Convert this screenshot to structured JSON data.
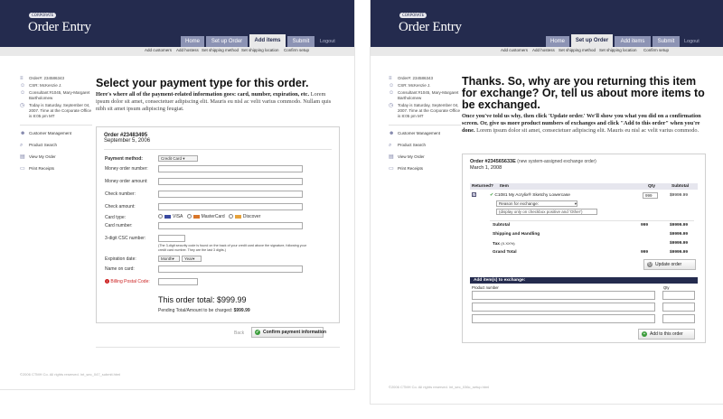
{
  "left": {
    "brand_tag": "CORPORATE",
    "brand": "Order Entry",
    "tabs": [
      "Home",
      "Set up Order",
      "Add items",
      "Submit"
    ],
    "logout": "Logout",
    "subnav": [
      "Add customers",
      "Add hostess",
      "Set shipping method",
      "Set shipping location",
      "Confirm setup"
    ],
    "side_info": [
      {
        "icon": "≡",
        "text": "Order#: 234586343"
      },
      {
        "icon": "☺",
        "text": "CSR: McKenzie J."
      },
      {
        "icon": "☺",
        "text": "Consultant:#1045, Mary-Margaret Bartholomew"
      },
      {
        "icon": "◷",
        "text": "Today is Saturday, September 04, 2007. Time at the Corporate Office is 8:05 pm MT"
      }
    ],
    "side_links": [
      "Customer Management",
      "Product Search",
      "View My Order",
      "Print Receipts"
    ],
    "title": "Select your payment type for this order.",
    "intro_bold": "Here's where all of the payment-related information goes: card, number, expiration, etc.",
    "intro_rest": "Lorem ipsum dolor sit amet, consectetuer adipiscing elit. Mauris eu nisl ac velit varius commodo. Nullam quis nibh sit amet ipsum adipiscing feugiat.",
    "order_no": "Order #23483495",
    "order_date": "September 5, 2006",
    "payment_method_label": "Payment method:",
    "payment_method_value": "Credit Card",
    "fields": [
      "Money order number:",
      "Money order amount:",
      "Check number:",
      "Check amount:"
    ],
    "card_type_label": "Card type:",
    "card_types": [
      "VISA",
      "MasterCard",
      "Discover"
    ],
    "card_number_label": "Card number:",
    "csc_label": "3-digit CSC number:",
    "csc_help": "(The 3-digit security code is found on the back of your credit card above the signature, following your credit card number. They are the last 3 digits.)",
    "exp_label": "Expiration date:",
    "exp_month": "Month",
    "exp_year": "Year",
    "name_label": "Name on card:",
    "billing_label": "Billing Postal Code:",
    "total_label": "This order total: $999.99",
    "pending_label": "Pending Total/Amount to be charged:",
    "pending_value": "$999.99",
    "back": "Back",
    "confirm_button": "Confirm payment information",
    "footer": "©2006 CTMH Co. All rights reserved. int_sec_047_submit.html"
  },
  "right": {
    "brand_tag": "CORPORATE",
    "brand": "Order Entry",
    "tabs": [
      "Home",
      "Set up Order",
      "Add items",
      "Submit"
    ],
    "logout": "Logout",
    "subnav": [
      "Add customers",
      "Add hostess",
      "Set shipping method",
      "Set shipping location",
      "Confirm setup"
    ],
    "side_info": [
      {
        "icon": "≡",
        "text": "Order#: 234586343"
      },
      {
        "icon": "☺",
        "text": "CSR: McKenzie J."
      },
      {
        "icon": "☺",
        "text": "Consultant:#1045, Mary-Margaret Bartholomew"
      },
      {
        "icon": "◷",
        "text": "Today is Saturday, September 04, 2007. Time at the Corporate Office is 8:05 pm MT"
      }
    ],
    "side_links": [
      "Customer Management",
      "Product Search",
      "View My Order",
      "Print Receipts"
    ],
    "title": "Thanks. So, why are you returning this item for exchange? Or, tell us about more items to be exchanged.",
    "intro_bold": "Once you've told us why, then click 'Update order.' We'll show you what you did on a confirmation screen. Or, give us more product numbers of exchanges and click \"Add to this order\" when you're done.",
    "intro_rest": "Lorem ipsum dolor sit amet, consectetuer adipiscing elit. Mauris eu nisl ac velit varius commodo.",
    "order_no": "Order #234565633E",
    "order_no_note": "(new system-assigned exchange order)",
    "order_date": "March 1, 2008",
    "cols": [
      "Returned?",
      "Item",
      "Qty",
      "Subtotal"
    ],
    "item_name": "C1081 My Acrylix® Sketchy Lowercase",
    "item_qty": "999",
    "item_subtotal": "$9999.99",
    "reason_select": "Reason for exchange:",
    "reason_note": "(display only on checkbox positive and 'Other')",
    "summary": [
      {
        "label": "Subtotal",
        "qty": "999",
        "value": "$9999.99"
      },
      {
        "label": "Shipping and Handling",
        "qty": "",
        "value": "$9999.99"
      },
      {
        "label": "Tax",
        "qty": "",
        "value": "$9999.99",
        "note": "(X.XX%)"
      },
      {
        "label": "Grand Total",
        "qty": "999",
        "value": "$9999.99"
      }
    ],
    "update_button": "Update order",
    "add_header": "Add item(s) to exchange:",
    "add_col_product": "Product number",
    "add_col_qty": "Qty",
    "add_button": "Add to this order",
    "footer": "©2006 CTMH Co. All rights reserved. int_sec_036c_setup.html"
  },
  "colors": {
    "header": "#242b4e",
    "tab": "#8c93b4",
    "tab_active": "#e9e9e9",
    "confirm_icon": "#3a9c3a",
    "warn": "#cc2222"
  }
}
